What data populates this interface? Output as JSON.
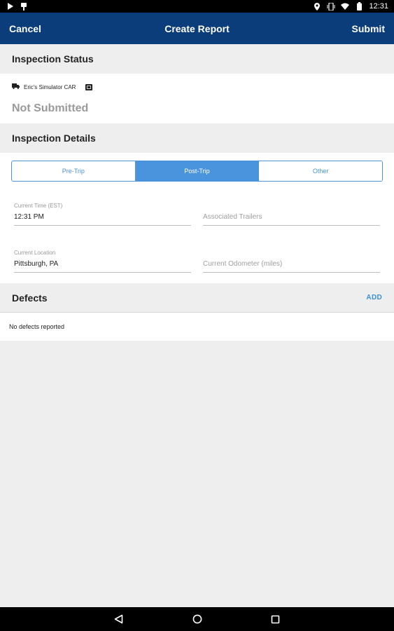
{
  "status_bar": {
    "time": "12:31",
    "left_icons": [
      "play-icon",
      "notification-icon"
    ],
    "right_icons": [
      "location-icon",
      "vibrate-icon",
      "wifi-icon",
      "battery-icon"
    ]
  },
  "app_bar": {
    "cancel_label": "Cancel",
    "title": "Create Report",
    "submit_label": "Submit",
    "background": "#0a3d7a"
  },
  "inspection_status": {
    "title": "Inspection Status",
    "vehicle_name": "Eric's Simulator CAR",
    "vehicle_icon": "truck-icon",
    "badge_icon": "eld-icon",
    "status": "Not Submitted"
  },
  "inspection_details": {
    "title": "Inspection Details",
    "segments": [
      {
        "label": "Pre-Trip",
        "active": false
      },
      {
        "label": "Post-Trip",
        "active": true
      },
      {
        "label": "Other",
        "active": false
      }
    ],
    "accent": "#4a94dd",
    "fields": {
      "current_time": {
        "label": "Current Time (EST)",
        "value": "12:31 PM"
      },
      "associated_trailers": {
        "placeholder": "Associated Trailers"
      },
      "current_location": {
        "label": "Current Location",
        "value": "Pittsburgh, PA"
      },
      "current_odometer": {
        "placeholder": "Current Odometer (miles)"
      }
    }
  },
  "defects": {
    "title": "Defects",
    "add_label": "ADD",
    "empty_text": "No defects reported"
  },
  "nav_bar": {
    "icons": [
      "back-icon",
      "home-icon",
      "recents-icon"
    ]
  }
}
